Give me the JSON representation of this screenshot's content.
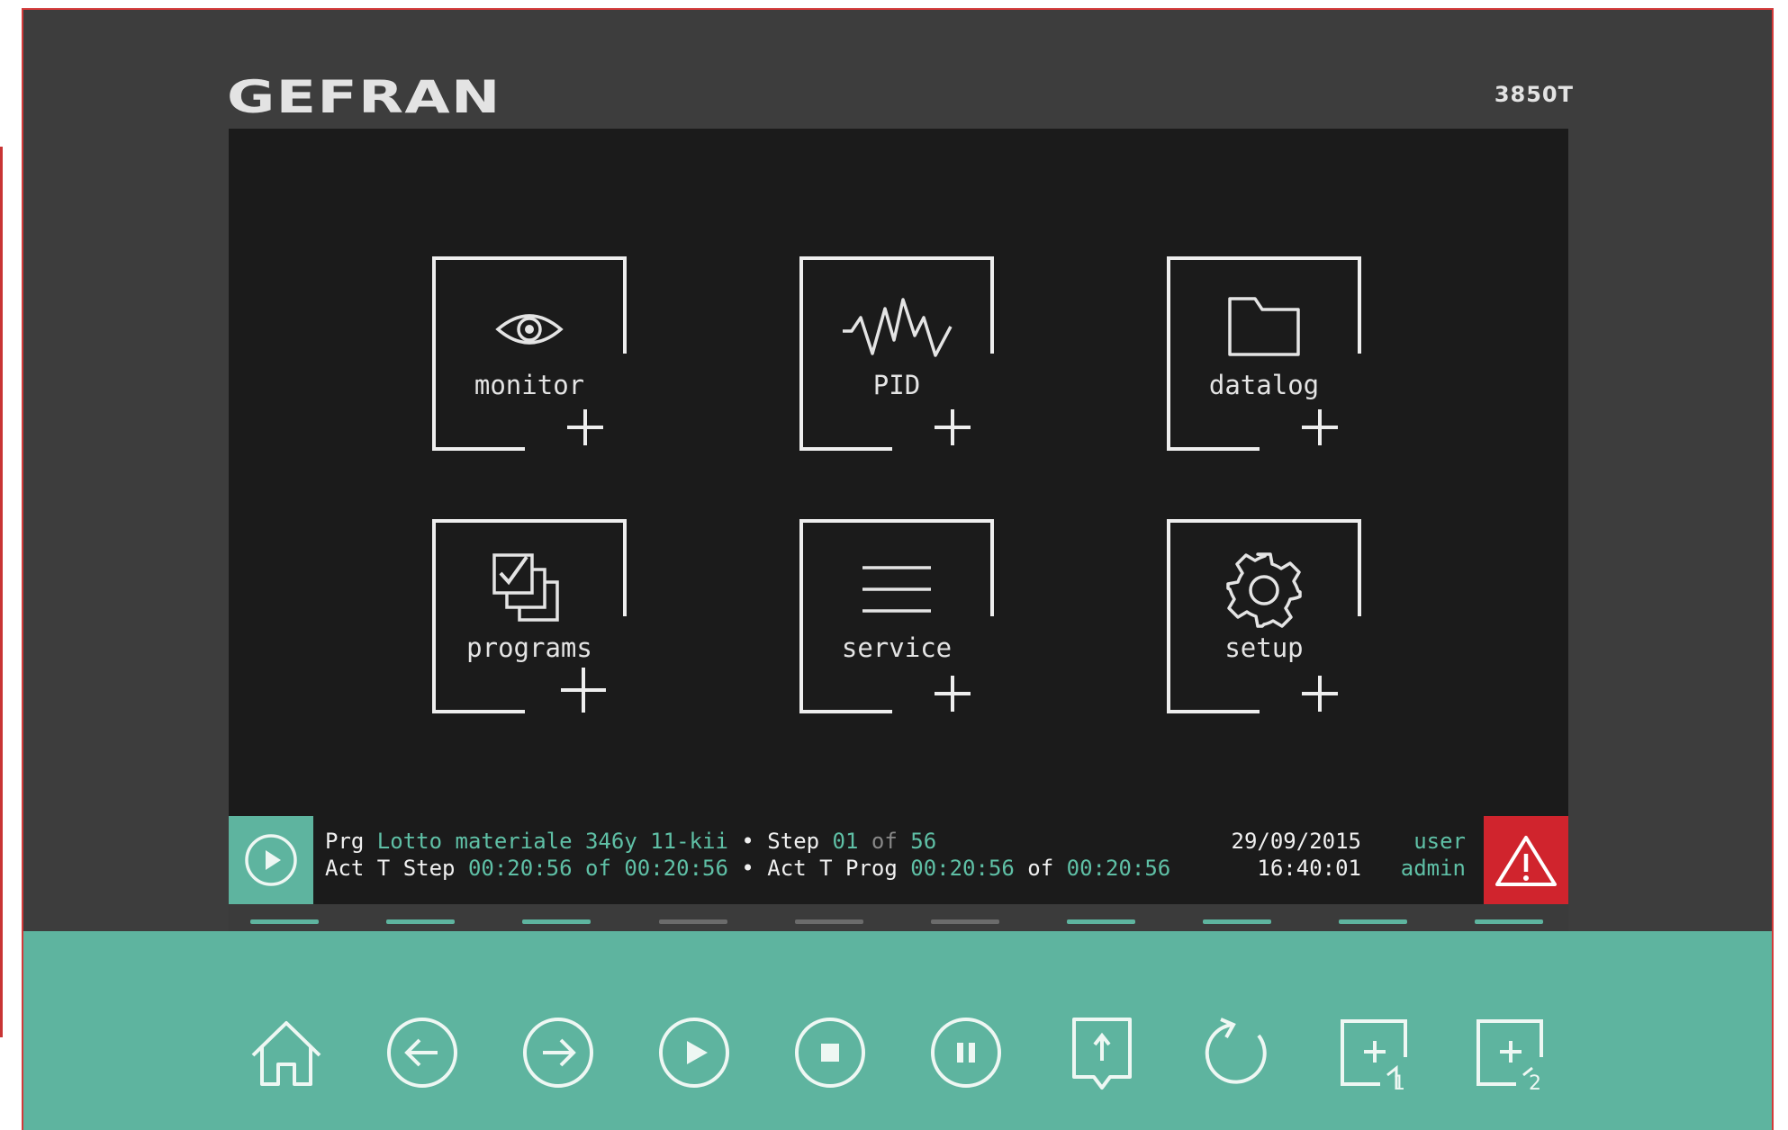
{
  "header": {
    "brand": "GEFRAN",
    "model": "3850T"
  },
  "tiles": [
    {
      "label": "monitor",
      "icon": "eye-icon"
    },
    {
      "label": "PID",
      "icon": "pulse-wave-icon"
    },
    {
      "label": "datalog",
      "icon": "folder-icon"
    },
    {
      "label": "programs",
      "icon": "checked-stack-icon"
    },
    {
      "label": "service",
      "icon": "list-lines-icon"
    },
    {
      "label": "setup",
      "icon": "gear-icon"
    }
  ],
  "status": {
    "line1": {
      "prg": "Prg ",
      "program_name": "Lotto materiale 346y 11-kii",
      "sep": " • ",
      "step_label": "Step ",
      "step_value": "01",
      "of": " of ",
      "step_total": "56"
    },
    "line2": {
      "act_step": "Act T Step ",
      "step_time": "00:20:56",
      "of1": " of ",
      "step_time_total": "00:20:56",
      "sep": " • ",
      "act_prog": "Act T Prog ",
      "prog_time": "00:20:56",
      "of2": " of ",
      "prog_time_total": "00:20:56"
    },
    "date": "29/09/2015",
    "time": "16:40:01",
    "user_label": "user",
    "user_name": "admin"
  },
  "indicators": [
    "active",
    "active",
    "active",
    "inactive",
    "inactive",
    "inactive",
    "active",
    "active",
    "active",
    "active"
  ],
  "colors": {
    "accent": "#5eb49f",
    "alarm": "#d0242d",
    "active": "#5eb49f",
    "inactive": "#6b6b6b"
  },
  "toolbar": [
    "home-icon",
    "back-arrow-icon",
    "forward-arrow-icon",
    "play-icon",
    "stop-icon",
    "pause-icon",
    "upload-icon",
    "restart-icon",
    "add-1-icon",
    "add-2-icon"
  ]
}
